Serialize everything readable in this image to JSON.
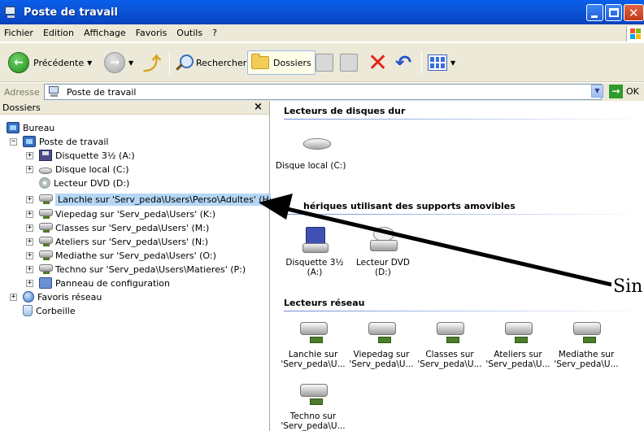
{
  "window": {
    "title": "Poste de travail"
  },
  "menu": [
    "Fichier",
    "Edition",
    "Affichage",
    "Favoris",
    "Outils",
    "?"
  ],
  "toolbar": {
    "back_label": "Précédente",
    "search_label": "Rechercher",
    "folders_label": "Dossiers"
  },
  "address": {
    "label": "Adresse",
    "value": "Poste de travail",
    "go_label": "OK"
  },
  "folders_panel": {
    "title": "Dossiers",
    "close_glyph": "×",
    "tree": [
      {
        "label": "Bureau",
        "icon": "desktop-icon",
        "expander": ""
      },
      {
        "label": "Poste de travail",
        "icon": "computer-icon",
        "expander": "−"
      },
      {
        "label": "Disquette 3½ (A:)",
        "icon": "floppy-icon",
        "expander": "+"
      },
      {
        "label": "Disque local (C:)",
        "icon": "hard-disk-icon",
        "expander": "+"
      },
      {
        "label": "Lecteur DVD (D:)",
        "icon": "dvd-icon",
        "expander": ""
      },
      {
        "label": "Lanchie sur 'Serv_peda\\Users\\Perso\\Adultes' (H:)",
        "icon": "network-drive-icon",
        "expander": "+"
      },
      {
        "label": "Viepedag sur 'Serv_peda\\Users' (K:)",
        "icon": "network-drive-icon",
        "expander": "+"
      },
      {
        "label": "Classes sur 'Serv_peda\\Users' (M:)",
        "icon": "network-drive-icon",
        "expander": "+"
      },
      {
        "label": "Ateliers sur 'Serv_peda\\Users' (N:)",
        "icon": "network-drive-icon",
        "expander": "+"
      },
      {
        "label": "Mediathe sur 'Serv_peda\\Users' (O:)",
        "icon": "network-drive-icon",
        "expander": "+"
      },
      {
        "label": "Techno sur 'Serv_peda\\Users\\Matieres' (P:)",
        "icon": "network-drive-icon",
        "expander": "+"
      },
      {
        "label": "Panneau de configuration",
        "icon": "control-panel-icon",
        "expander": "+"
      },
      {
        "label": "Favoris réseau",
        "icon": "network-places-icon",
        "expander": "+"
      },
      {
        "label": "Corbeille",
        "icon": "recycle-bin-icon",
        "expander": ""
      }
    ]
  },
  "content": {
    "groups": [
      {
        "title": "Lecteurs de disques dur",
        "items": [
          {
            "label": "Disque local (C:)",
            "icon": "hard-disk-icon"
          }
        ]
      },
      {
        "title": "Périphériques utilisant des supports amovibles",
        "title_visible": "hériques utilisant des supports amovibles",
        "items": [
          {
            "label": "Disquette 3½ (A:)",
            "icon": "floppy-icon"
          },
          {
            "label": "Lecteur DVD (D:)",
            "icon": "dvd-icon"
          }
        ]
      },
      {
        "title": "Lecteurs réseau",
        "items": [
          {
            "label": "Lanchie sur 'Serv_peda\\U...",
            "icon": "network-drive-icon"
          },
          {
            "label": "Viepedag sur 'Serv_peda\\U...",
            "icon": "network-drive-icon"
          },
          {
            "label": "Classes sur 'Serv_peda\\U...",
            "icon": "network-drive-icon"
          },
          {
            "label": "Ateliers sur 'Serv_peda\\U...",
            "icon": "network-drive-icon"
          },
          {
            "label": "Mediathe sur 'Serv_peda\\U...",
            "icon": "network-drive-icon"
          },
          {
            "label": "Techno sur 'Serv_peda\\U...",
            "icon": "network-drive-icon"
          }
        ]
      }
    ]
  },
  "annotation": {
    "text": "Sin"
  },
  "colors": {
    "titlebar": "#0b55d8",
    "selection": "#b4d7f5",
    "chrome": "#ece9d8"
  }
}
